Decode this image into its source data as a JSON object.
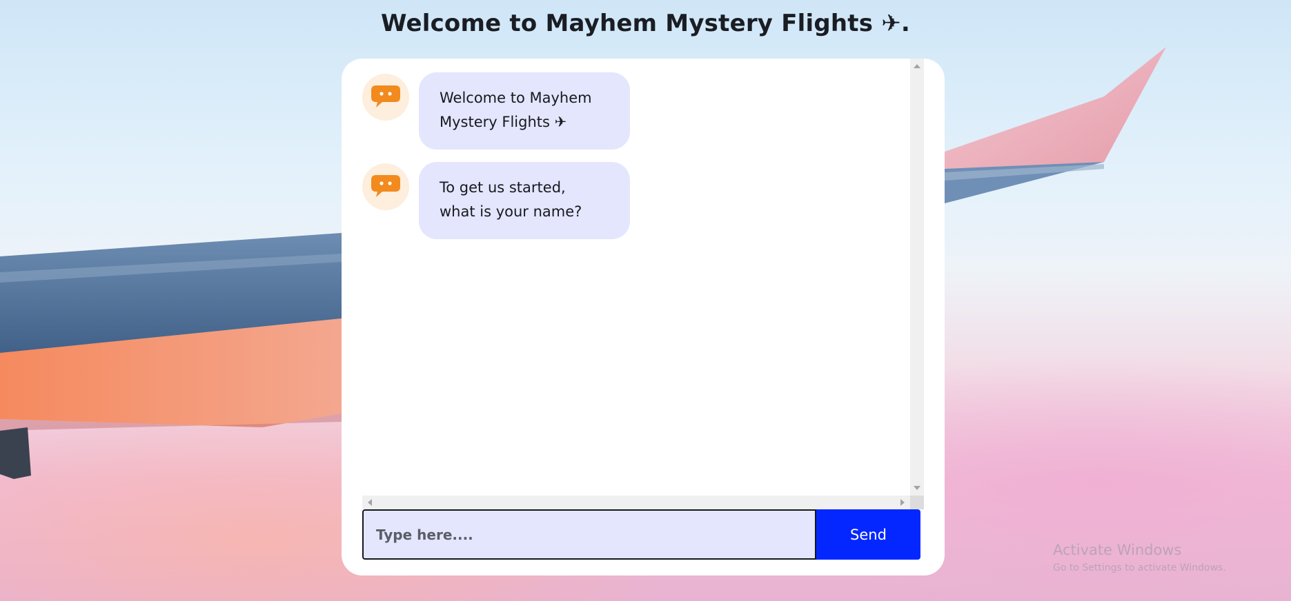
{
  "page": {
    "title": "Welcome to Mayhem Mystery Flights ✈."
  },
  "chat": {
    "messages": [
      {
        "sender": "bot",
        "avatar_icon": "chat-bubble-icon",
        "text": "Welcome to Mayhem Mystery Flights ✈"
      },
      {
        "sender": "bot",
        "avatar_icon": "chat-bubble-icon",
        "text": "To get us started, what is your name?"
      }
    ],
    "input": {
      "placeholder": "Type here....",
      "value": ""
    },
    "send_label": "Send"
  },
  "watermark": {
    "line1": "Activate Windows",
    "line2": "Go to Settings to activate Windows."
  },
  "colors": {
    "accent_button": "#0527ff",
    "bubble": "#e3e6fd",
    "avatar_bg": "#fdeedd",
    "avatar_icon": "#f28a1e"
  }
}
